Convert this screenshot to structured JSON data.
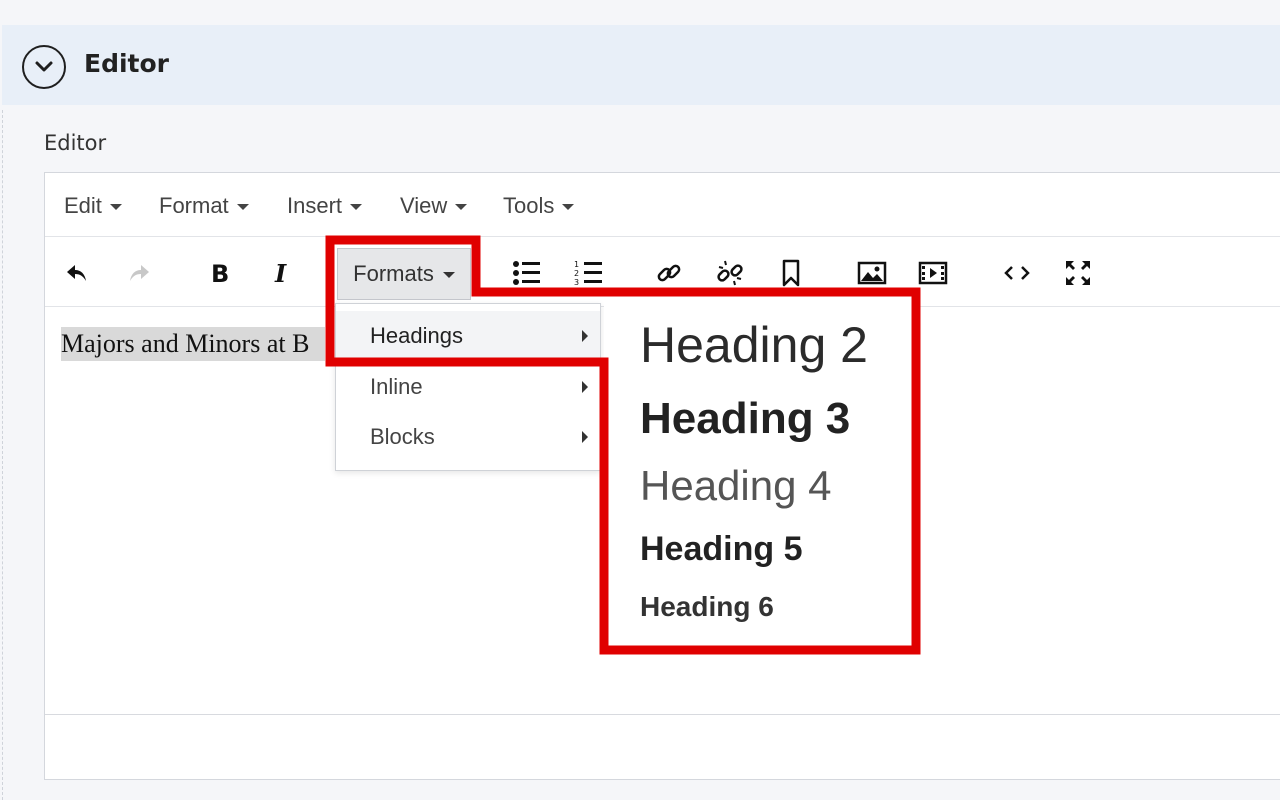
{
  "panel": {
    "title": "Editor",
    "collapse_icon": "chevron-down-icon"
  },
  "field": {
    "label": "Editor"
  },
  "menubar": {
    "items": [
      {
        "label": "Edit"
      },
      {
        "label": "Format"
      },
      {
        "label": "Insert"
      },
      {
        "label": "View"
      },
      {
        "label": "Tools"
      }
    ]
  },
  "toolbar": {
    "formats_label": "Formats",
    "icons": [
      "undo-icon",
      "redo-icon",
      "bold-icon",
      "italic-icon",
      "bullet-list-icon",
      "numbered-list-icon",
      "link-icon",
      "unlink-icon",
      "bookmark-icon",
      "image-icon",
      "video-icon",
      "code-icon",
      "fullscreen-icon"
    ]
  },
  "content": {
    "text": "Majors and Minors at B"
  },
  "formats_menu": {
    "items": [
      {
        "label": "Headings"
      },
      {
        "label": "Inline"
      },
      {
        "label": "Blocks"
      }
    ]
  },
  "headings_menu": {
    "items": [
      {
        "label": "Heading 2"
      },
      {
        "label": "Heading 3"
      },
      {
        "label": "Heading 4"
      },
      {
        "label": "Heading 5"
      },
      {
        "label": "Heading 6"
      }
    ]
  },
  "colors": {
    "highlight": "#e00000",
    "header_bg": "#e8eff8"
  }
}
